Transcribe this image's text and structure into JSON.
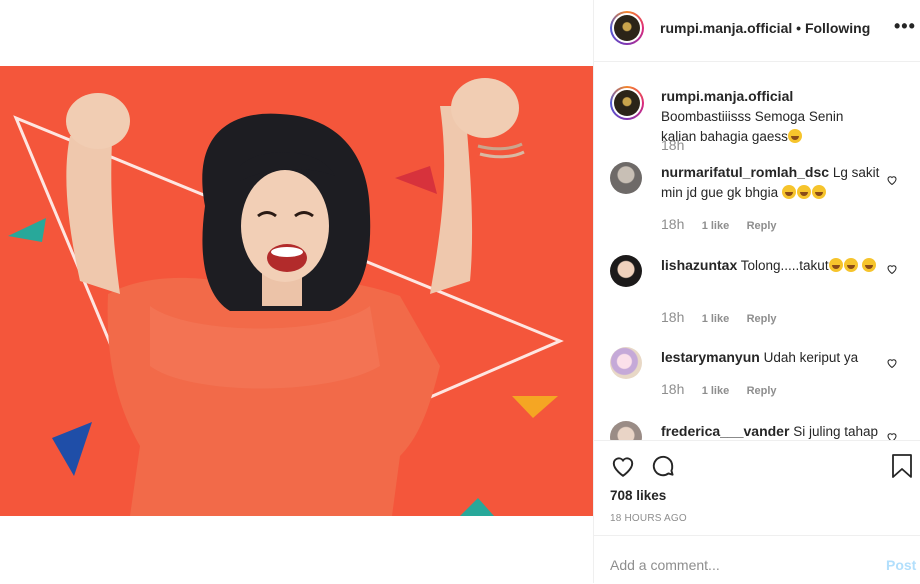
{
  "post": {
    "username": "rumpi.manja.official",
    "follow_status": "Following",
    "separator": "•",
    "more_label": "•••",
    "caption": "Boombastiiisss Semoga Senin kalian bahagia gaess",
    "caption_time": "18h",
    "likes": "708 likes",
    "time_ago": "18 HOURS AGO"
  },
  "comments": [
    {
      "user": "nurmarifatul_romlah_dsc",
      "text": "Lg sakit min jd gue gk bhgia",
      "time": "18h",
      "likes": "1 like",
      "reply": "Reply"
    },
    {
      "user": "lishazuntax",
      "text": "Tolong.....takut",
      "time": "18h",
      "likes": "1 like",
      "reply": "Reply"
    },
    {
      "user": "lestarymanyun",
      "text": "Udah keriput ya",
      "time": "18h",
      "likes": "1 like",
      "reply": "Reply"
    },
    {
      "user": "frederica___vander",
      "text": "Si juling tahap",
      "time": "",
      "likes": "",
      "reply": ""
    }
  ],
  "comment_box": {
    "placeholder": "Add a comment...",
    "post_label": "Post"
  },
  "colors": {
    "photo_bg": "#f4563b",
    "link_disabled": "#b2dffc",
    "muted": "#8e8e8e"
  },
  "icons": [
    "more-icon",
    "heart-icon",
    "comment-icon",
    "bookmark-icon"
  ]
}
